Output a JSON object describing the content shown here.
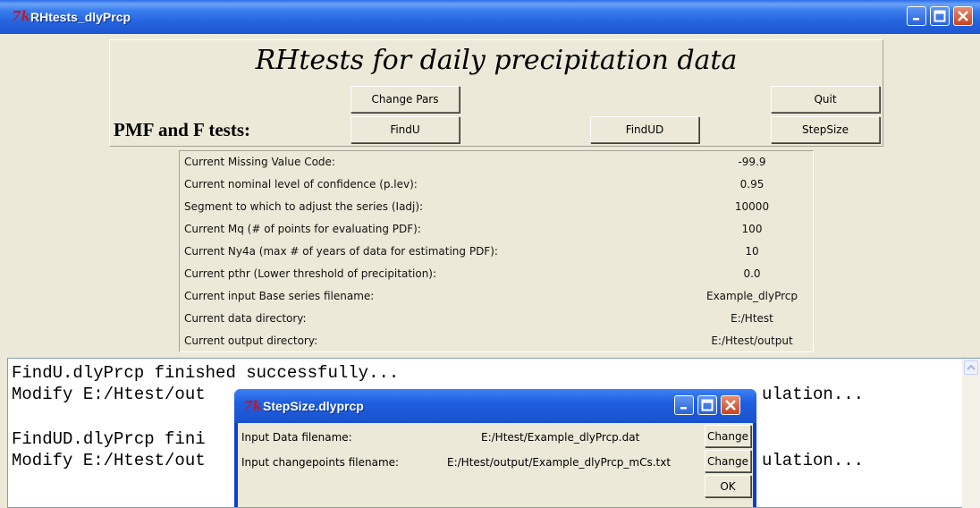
{
  "window": {
    "title": "RHtests_dlyPrcp",
    "logo": "7k"
  },
  "header": {
    "title": "RHtests for daily precipitation data",
    "section_label": "PMF and F tests:"
  },
  "buttons": {
    "change_pars": "Change Pars",
    "quit": "Quit",
    "findu": "FindU",
    "findud": "FindUD",
    "stepsize": "StepSize"
  },
  "params": [
    {
      "label": "Current Missing Value Code:",
      "value": "-99.9"
    },
    {
      "label": "Current nominal level of confidence (p.lev):",
      "value": "0.95"
    },
    {
      "label": "Segment to which to adjust the series (Iadj):",
      "value": "10000"
    },
    {
      "label": "Current Mq (# of points for evaluating PDF):",
      "value": "100"
    },
    {
      "label": "Current Ny4a (max # of years of data for estimating PDF):",
      "value": "10"
    },
    {
      "label": "Current pthr (Lower threshold of precipitation):",
      "value": "0.0"
    },
    {
      "label": "Current input Base series filename:",
      "value": "Example_dlyPrcp"
    },
    {
      "label": "Current data directory:",
      "value": "E:/Htest"
    },
    {
      "label": "Current output directory:",
      "value": "E:/Htest/output"
    }
  ],
  "log": {
    "line1": "FindU.dlyPrcp finished successfully...",
    "line2a": "Modify E:/Htest/out",
    "line2b": "ulation...",
    "line3a": "FindUD.dlyPrcp fini",
    "line4a": "Modify E:/Htest/out",
    "line4b": "ulation..."
  },
  "dialog": {
    "title": "StepSize.dlyprcp",
    "logo": "7k",
    "data_label": "Input Data filename:",
    "data_value": "E:/Htest/Example_dlyPrcp.dat",
    "cp_label": "Input changepoints filename:",
    "cp_value": "E:/Htest/output/Example_dlyPrcp_mCs.txt",
    "change_label": "Change",
    "ok_label": "OK"
  },
  "icons": {
    "minimize": "minimize-icon",
    "maximize": "maximize-icon",
    "close": "close-icon",
    "app": "tk-feather-icon",
    "scroll_up": "scroll-up-icon"
  }
}
